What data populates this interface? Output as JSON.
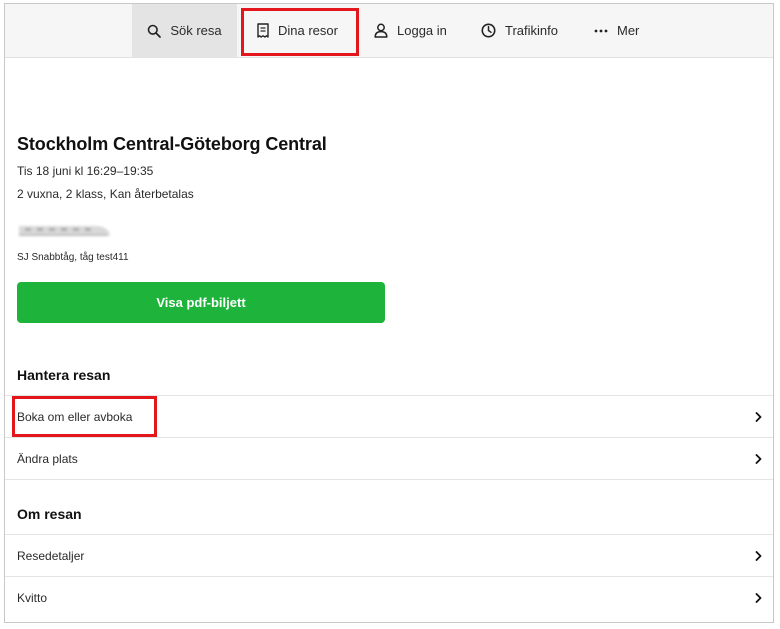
{
  "nav": {
    "items": [
      {
        "label": "Sök resa",
        "icon": "search-icon"
      },
      {
        "label": "Dina resor",
        "icon": "ticket-icon"
      },
      {
        "label": "Logga in",
        "icon": "user-icon"
      },
      {
        "label": "Trafikinfo",
        "icon": "clock-icon"
      },
      {
        "label": "Mer",
        "icon": "more-dots-icon"
      }
    ]
  },
  "trip": {
    "title": "Stockholm Central-Göteborg Central",
    "datetime": "Tis 18 juni kl 16:29–19:35",
    "passengers": "2 vuxna, 2 klass, Kan återbetalas",
    "train_caption": "SJ Snabbtåg, tåg test411",
    "pdf_button": "Visa pdf-biljett"
  },
  "manage": {
    "heading": "Hantera resan",
    "items": [
      {
        "label": "Boka om eller avboka"
      },
      {
        "label": "Ändra plats"
      }
    ]
  },
  "about": {
    "heading": "Om resan",
    "items": [
      {
        "label": "Resedetaljer"
      },
      {
        "label": "Kvitto"
      }
    ]
  },
  "colors": {
    "accent_green": "#1eb43c",
    "highlight_red": "#e3161b"
  }
}
